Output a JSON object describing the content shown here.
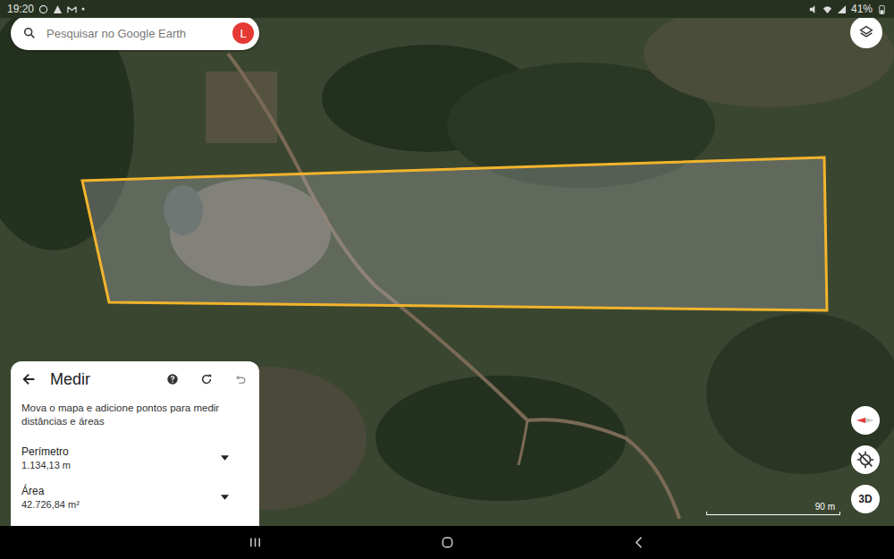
{
  "status_bar": {
    "time": "19:20",
    "battery": "41%"
  },
  "search": {
    "placeholder": "Pesquisar no Google Earth",
    "avatar": "L"
  },
  "measure_panel": {
    "title": "Medir",
    "hint": "Mova o mapa e adicione pontos para medir distâncias e áreas",
    "measurements": [
      {
        "label": "Perímetro",
        "value": "1.134,13 m"
      },
      {
        "label": "Área",
        "value": "42.726,84 m²"
      }
    ]
  },
  "map": {
    "scale": "90 m",
    "view_button": "3D"
  }
}
